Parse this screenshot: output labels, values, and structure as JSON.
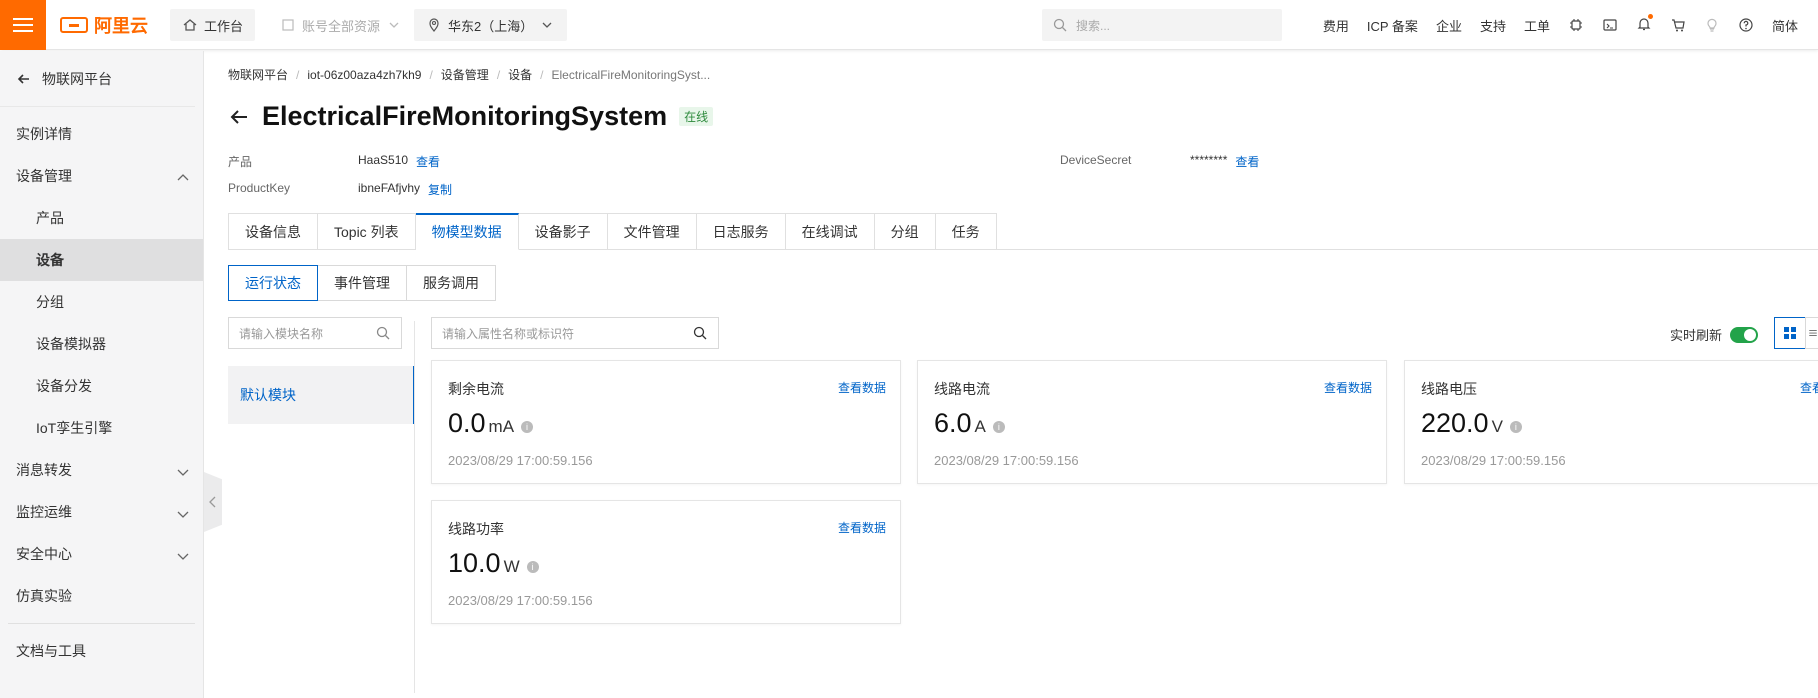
{
  "topbar": {
    "logo_text": "阿里云",
    "workbench": "工作台",
    "account_scope": "账号全部资源",
    "region": "华东2（上海）",
    "search_placeholder": "搜索...",
    "links": [
      "费用",
      "ICP 备案",
      "企业",
      "支持",
      "工单"
    ],
    "lang": "简体"
  },
  "sidebar": {
    "back_label": "物联网平台",
    "items": [
      {
        "label": "实例详情"
      },
      {
        "label": "设备管理"
      },
      {
        "label": "产品"
      },
      {
        "label": "设备"
      },
      {
        "label": "分组"
      },
      {
        "label": "设备模拟器"
      },
      {
        "label": "设备分发"
      },
      {
        "label": "IoT孪生引擎"
      },
      {
        "label": "消息转发"
      },
      {
        "label": "监控运维"
      },
      {
        "label": "安全中心"
      },
      {
        "label": "仿真实验"
      },
      {
        "label": "文档与工具"
      }
    ]
  },
  "breadcrumb": [
    "物联网平台",
    "iot-06z00aza4zh7kh9",
    "设备管理",
    "设备",
    "ElectricalFireMonitoringSyst..."
  ],
  "device": {
    "title": "ElectricalFireMonitoringSystem",
    "status": "在线",
    "product_label": "产品",
    "product_value": "HaaS510",
    "product_link": "查看",
    "productkey_label": "ProductKey",
    "productkey_value": "ibneFAfjvhy",
    "productkey_link": "复制",
    "secret_label": "DeviceSecret",
    "secret_value": "********",
    "secret_link": "查看"
  },
  "tabs": [
    "设备信息",
    "Topic 列表",
    "物模型数据",
    "设备影子",
    "文件管理",
    "日志服务",
    "在线调试",
    "分组",
    "任务"
  ],
  "subtabs": [
    "运行状态",
    "事件管理",
    "服务调用"
  ],
  "module_search_placeholder": "请输入模块名称",
  "property_search_placeholder": "请输入属性名称或标识符",
  "default_module": "默认模块",
  "realtime_refresh": "实时刷新",
  "cards": [
    {
      "title": "剩余电流",
      "link": "查看数据",
      "value": "0.0",
      "unit": "mA",
      "time": "2023/08/29 17:00:59.156"
    },
    {
      "title": "线路电流",
      "link": "查看数据",
      "value": "6.0",
      "unit": "A",
      "time": "2023/08/29 17:00:59.156"
    },
    {
      "title": "线路电压",
      "link": "查看数据",
      "value": "220.0",
      "unit": "V",
      "time": "2023/08/29 17:00:59.156"
    },
    {
      "title": "线路功率",
      "link": "查看数据",
      "value": "10.0",
      "unit": "W",
      "time": "2023/08/29 17:00:59.156"
    }
  ],
  "colors": {
    "brand": "#ff6a00",
    "accent": "#0064c8",
    "online": "#2e8b3d",
    "toggle_on": "#23a34a"
  }
}
